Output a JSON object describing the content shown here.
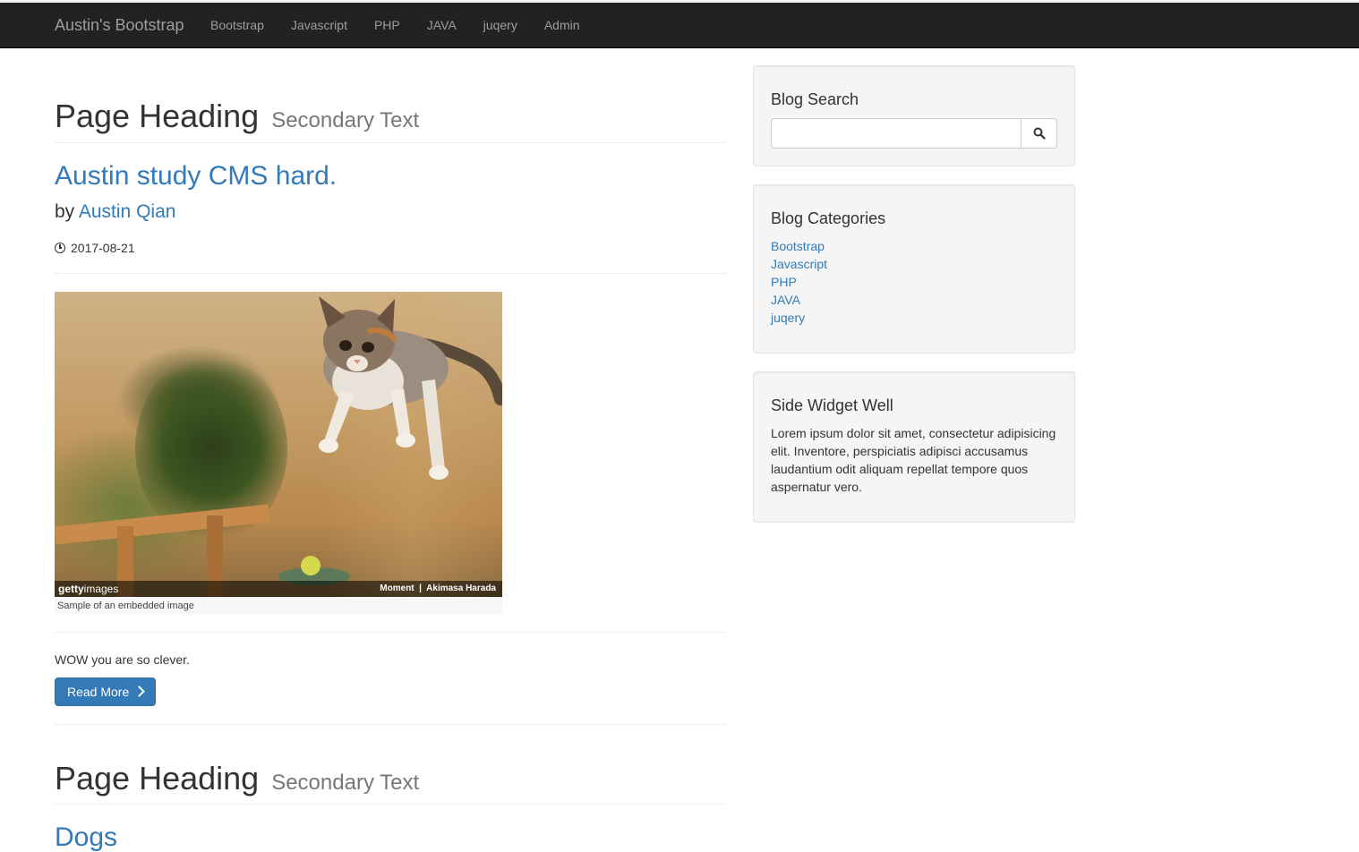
{
  "navbar": {
    "brand": "Austin's Bootstrap",
    "links": [
      "Bootstrap",
      "Javascript",
      "PHP",
      "JAVA",
      "juqery",
      "Admin"
    ]
  },
  "posts": [
    {
      "heading": "Page Heading",
      "subheading": "Secondary Text",
      "title": "Austin study CMS hard.",
      "by": "by",
      "author": "Austin Qian",
      "date": "2017-08-21",
      "image_logo_bold": "getty",
      "image_logo_light": "images",
      "image_credit": "Moment  |  Akimasa Harada",
      "image_caption": "Sample of an embedded image",
      "body": "WOW you are so clever.",
      "button": "Read More"
    },
    {
      "heading": "Page Heading",
      "subheading": "Secondary Text",
      "title": "Dogs"
    }
  ],
  "sidebar": {
    "search": {
      "title": "Blog Search",
      "placeholder": ""
    },
    "categories": {
      "title": "Blog Categories",
      "items": [
        "Bootstrap",
        "Javascript",
        "PHP",
        "JAVA",
        "juqery"
      ]
    },
    "widget": {
      "title": "Side Widget Well",
      "text": "Lorem ipsum dolor sit amet, consectetur adipisicing elit. Inventore, perspiciatis adipisci accusamus laudantium odit aliquam repellat tempore quos aspernatur vero."
    }
  },
  "colors": {
    "navbar": "#222222",
    "link": "#337ab7",
    "button": "#337ab7",
    "well": "#f5f5f5"
  }
}
